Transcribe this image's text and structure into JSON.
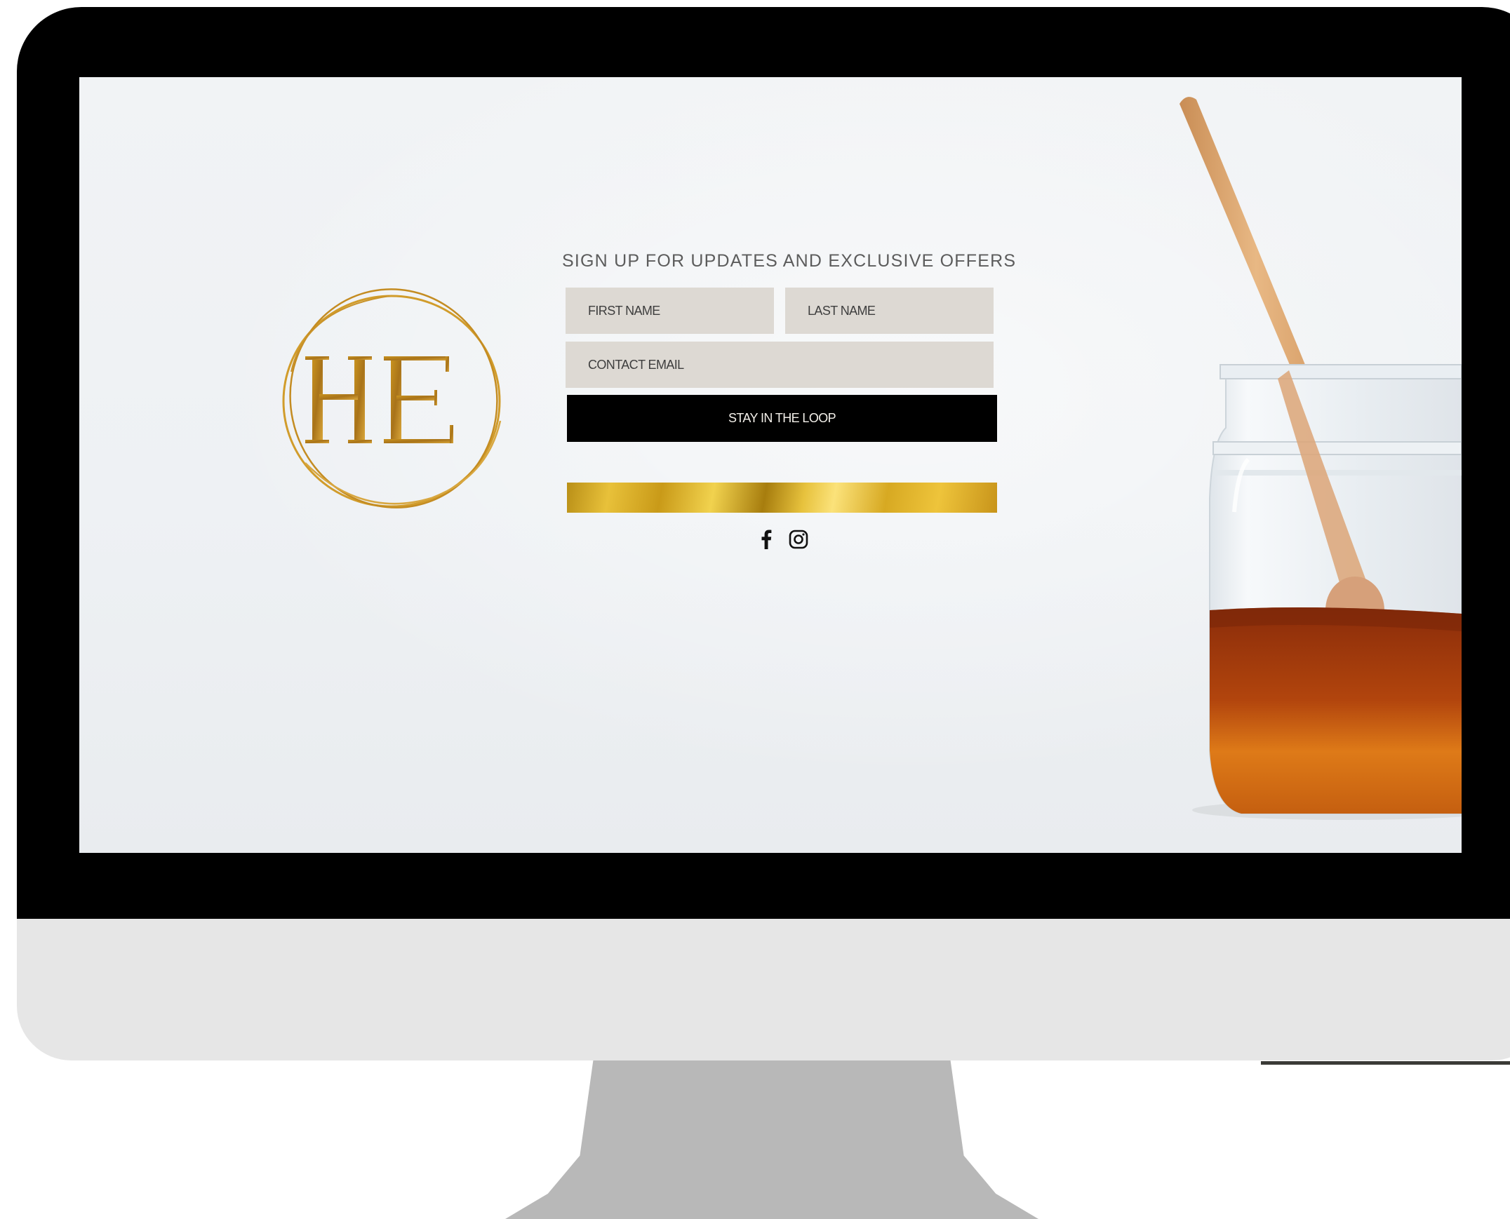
{
  "signup": {
    "heading": "SIGN UP FOR UPDATES AND EXCLUSIVE OFFERS",
    "first_name_placeholder": "FIRST NAME",
    "last_name_placeholder": "LAST NAME",
    "email_placeholder": "CONTACT EMAIL",
    "submit_label": "STAY IN THE LOOP"
  },
  "logo": {
    "monogram": "HE"
  },
  "social": {
    "icons": [
      "facebook-icon",
      "instagram-icon"
    ]
  },
  "colors": {
    "field_bg": "#ddd9d3",
    "button_bg": "#000000",
    "gold_accent": "#d4a62a",
    "screen_bg": "#eef1f4"
  }
}
